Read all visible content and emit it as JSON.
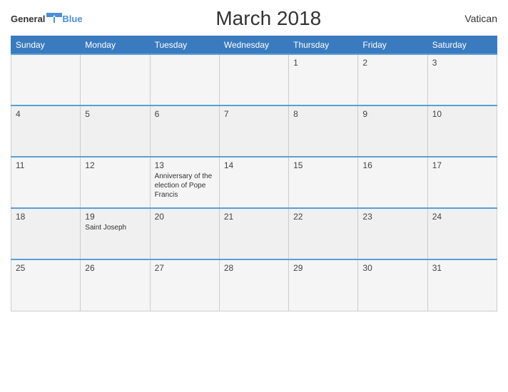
{
  "header": {
    "logo_general": "General",
    "logo_blue": "Blue",
    "title": "March 2018",
    "country": "Vatican"
  },
  "weekdays": [
    "Sunday",
    "Monday",
    "Tuesday",
    "Wednesday",
    "Thursday",
    "Friday",
    "Saturday"
  ],
  "weeks": [
    [
      {
        "day": "",
        "empty": true
      },
      {
        "day": "",
        "empty": true
      },
      {
        "day": "",
        "empty": true
      },
      {
        "day": "",
        "empty": true
      },
      {
        "day": "1",
        "event": ""
      },
      {
        "day": "2",
        "event": ""
      },
      {
        "day": "3",
        "event": ""
      }
    ],
    [
      {
        "day": "4",
        "event": ""
      },
      {
        "day": "5",
        "event": ""
      },
      {
        "day": "6",
        "event": ""
      },
      {
        "day": "7",
        "event": ""
      },
      {
        "day": "8",
        "event": ""
      },
      {
        "day": "9",
        "event": ""
      },
      {
        "day": "10",
        "event": ""
      }
    ],
    [
      {
        "day": "11",
        "event": ""
      },
      {
        "day": "12",
        "event": ""
      },
      {
        "day": "13",
        "event": "Anniversary of the election of Pope Francis"
      },
      {
        "day": "14",
        "event": ""
      },
      {
        "day": "15",
        "event": ""
      },
      {
        "day": "16",
        "event": ""
      },
      {
        "day": "17",
        "event": ""
      }
    ],
    [
      {
        "day": "18",
        "event": ""
      },
      {
        "day": "19",
        "event": "Saint Joseph"
      },
      {
        "day": "20",
        "event": ""
      },
      {
        "day": "21",
        "event": ""
      },
      {
        "day": "22",
        "event": ""
      },
      {
        "day": "23",
        "event": ""
      },
      {
        "day": "24",
        "event": ""
      }
    ],
    [
      {
        "day": "25",
        "event": ""
      },
      {
        "day": "26",
        "event": ""
      },
      {
        "day": "27",
        "event": ""
      },
      {
        "day": "28",
        "event": ""
      },
      {
        "day": "29",
        "event": ""
      },
      {
        "day": "30",
        "event": ""
      },
      {
        "day": "31",
        "event": ""
      }
    ]
  ]
}
